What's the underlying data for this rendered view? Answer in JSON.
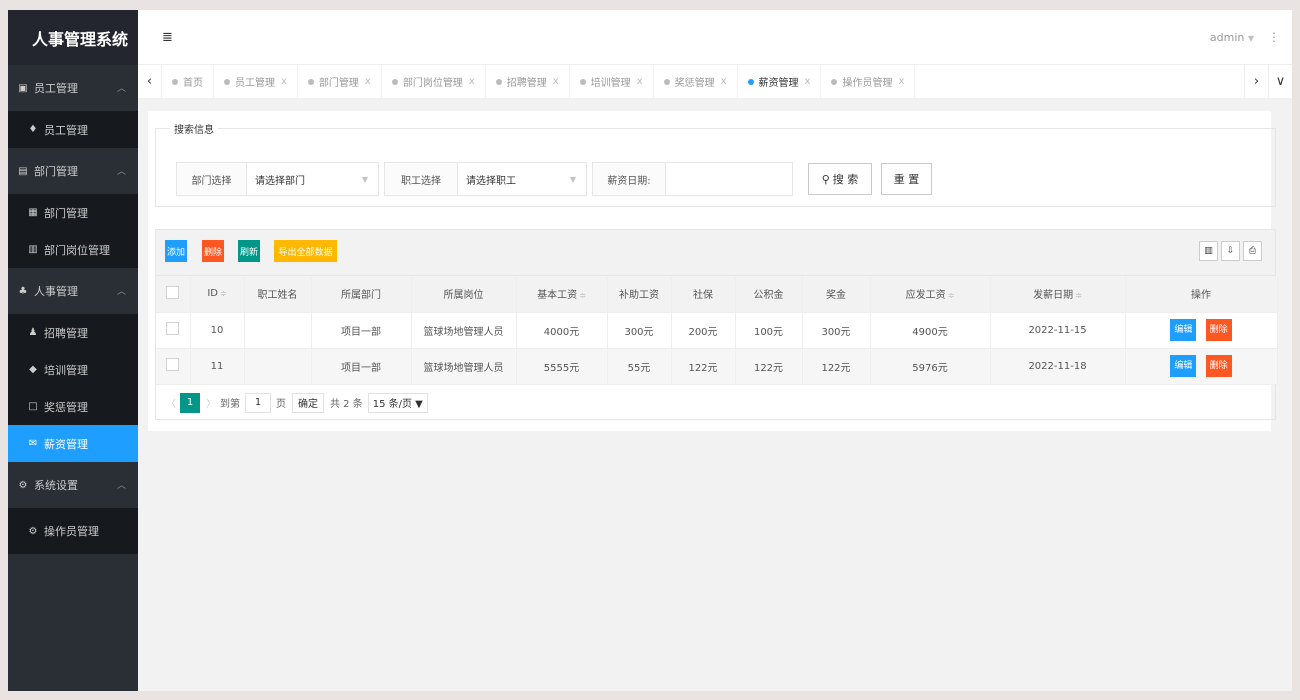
{
  "app": {
    "title": "人事管理系统"
  },
  "sidebar": {
    "groups": [
      {
        "label": "员工管理",
        "icon": "id-card-icon",
        "items": [
          {
            "label": "员工管理",
            "icon": "person-icon"
          }
        ]
      },
      {
        "label": "部门管理",
        "icon": "building-icon",
        "items": [
          {
            "label": "部门管理",
            "icon": "dept-icon"
          },
          {
            "label": "部门岗位管理",
            "icon": "card-icon"
          }
        ]
      },
      {
        "label": "人事管理",
        "icon": "users-icon",
        "items": [
          {
            "label": "招聘管理",
            "icon": "user-plus-icon"
          },
          {
            "label": "培训管理",
            "icon": "graduation-cap-icon"
          },
          {
            "label": "奖惩管理",
            "icon": "monitor-icon"
          },
          {
            "label": "薪资管理",
            "icon": "envelope-icon",
            "active": true
          }
        ]
      },
      {
        "label": "系统设置",
        "icon": "gears-icon",
        "items": [
          {
            "label": "操作员管理",
            "icon": "gears-icon"
          }
        ]
      }
    ]
  },
  "topbar": {
    "user": "admin",
    "user_caret": "▼",
    "more": "⋮",
    "menu_icon": "≣"
  },
  "tabs": [
    {
      "label": "首页",
      "closable": false
    },
    {
      "label": "员工管理",
      "closable": true
    },
    {
      "label": "部门管理",
      "closable": true
    },
    {
      "label": "部门岗位管理",
      "closable": true
    },
    {
      "label": "招聘管理",
      "closable": true
    },
    {
      "label": "培训管理",
      "closable": true
    },
    {
      "label": "奖惩管理",
      "closable": true
    },
    {
      "label": "薪资管理",
      "closable": true,
      "active": true
    },
    {
      "label": "操作员管理",
      "closable": true
    }
  ],
  "tab_close": "x",
  "search": {
    "legend": "搜索信息",
    "dept_label": "部门选择",
    "dept_value": "请选择部门",
    "emp_label": "职工选择",
    "emp_value": "请选择职工",
    "date_label": "薪资日期:",
    "date_value": "",
    "search_btn": "搜 索",
    "reset_btn": "重 置"
  },
  "toolbar": {
    "add": "添加",
    "delete": "删除",
    "refresh": "刷新",
    "export": "导出全部数据",
    "colors": {
      "add": "#1e9fff",
      "delete": "#ff5722",
      "refresh": "#009688",
      "export": "#ffb800"
    }
  },
  "table": {
    "headers": [
      "",
      "ID",
      "职工姓名",
      "所属部门",
      "所属岗位",
      "基本工资",
      "补助工资",
      "社保",
      "公积金",
      "奖金",
      "应发工资",
      "发薪日期",
      "操作"
    ],
    "rows": [
      [
        "",
        "10",
        "",
        "项目一部",
        "篮球场地管理人员",
        "4000元",
        "300元",
        "200元",
        "100元",
        "300元",
        "4900元",
        "2022-11-15"
      ],
      [
        "",
        "11",
        "",
        "项目一部",
        "篮球场地管理人员",
        "5555元",
        "55元",
        "122元",
        "122元",
        "122元",
        "5976元",
        "2022-11-18"
      ]
    ],
    "row_edit": "编辑",
    "row_delete": "删除"
  },
  "pager": {
    "prev": "〈",
    "current": "1",
    "next": "〉",
    "goto_label": "到第",
    "goto_value": "1",
    "page_unit": "页",
    "confirm": "确定",
    "total": "共 2 条",
    "per_page": "15 条/页 ▼"
  }
}
